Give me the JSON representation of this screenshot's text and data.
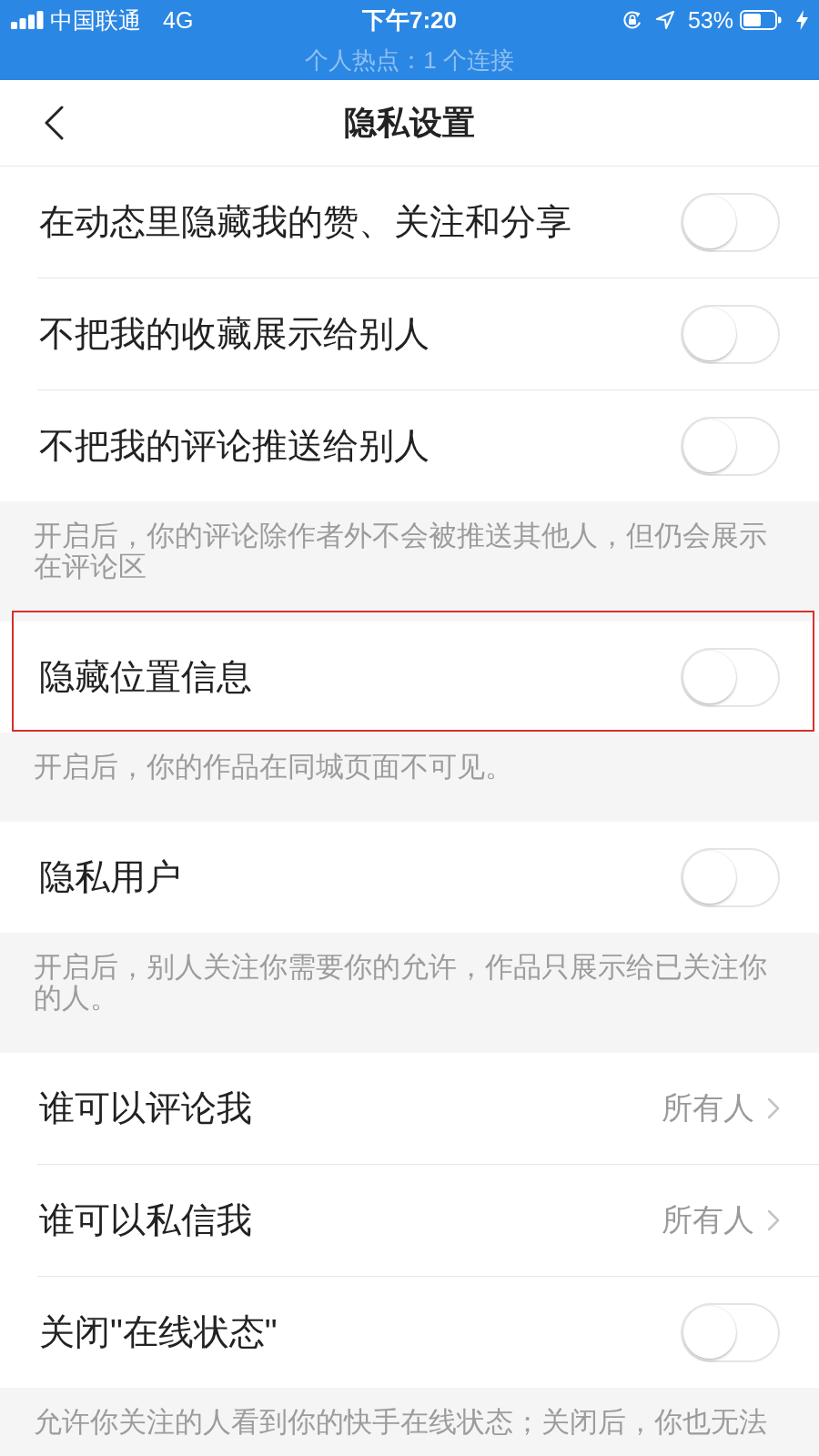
{
  "status_bar": {
    "carrier": "中国联通",
    "network": "4G",
    "time": "下午7:20",
    "battery": "53%",
    "hotspot": "个人热点：1 个连接"
  },
  "nav": {
    "title": "隐私设置"
  },
  "sections": [
    {
      "rows": [
        {
          "kind": "toggle",
          "label": "在动态里隐藏我的赞、关注和分享",
          "on": false,
          "highlighted": false
        },
        {
          "kind": "toggle",
          "label": "不把我的收藏展示给别人",
          "on": false,
          "highlighted": false
        },
        {
          "kind": "toggle",
          "label": "不把我的评论推送给别人",
          "on": false,
          "highlighted": false
        }
      ],
      "note": "开启后，你的评论除作者外不会被推送其他人，但仍会展示在评论区"
    },
    {
      "rows": [
        {
          "kind": "toggle",
          "label": "隐藏位置信息",
          "on": false,
          "highlighted": true
        }
      ],
      "note": "开启后，你的作品在同城页面不可见。"
    },
    {
      "rows": [
        {
          "kind": "toggle",
          "label": "隐私用户",
          "on": false,
          "highlighted": false
        }
      ],
      "note": "开启后，别人关注你需要你的允许，作品只展示给已关注你的人。"
    },
    {
      "rows": [
        {
          "kind": "link",
          "label": "谁可以评论我",
          "value": "所有人",
          "highlighted": false
        },
        {
          "kind": "link",
          "label": "谁可以私信我",
          "value": "所有人",
          "highlighted": false
        },
        {
          "kind": "toggle",
          "label": "关闭\"在线状态\"",
          "on": false,
          "highlighted": false
        }
      ],
      "note": "允许你关注的人看到你的快手在线状态；关闭后，你也无法"
    }
  ]
}
